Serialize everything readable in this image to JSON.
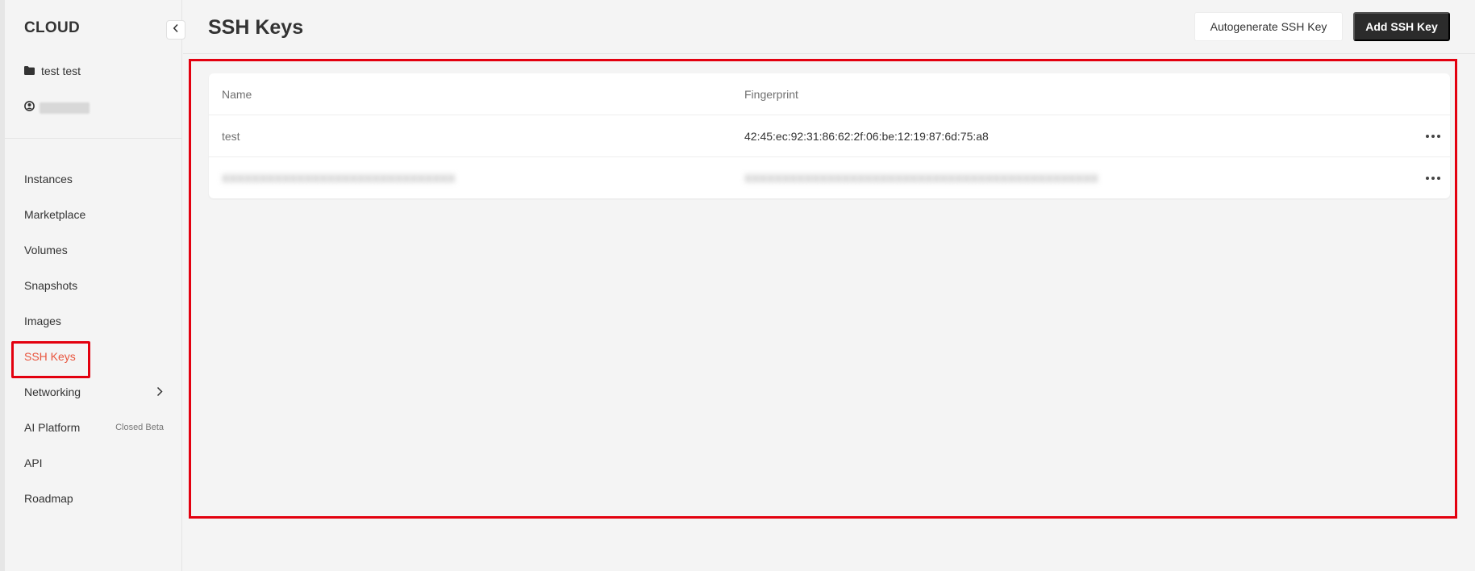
{
  "app": {
    "brand": "CLOUD"
  },
  "sidebar": {
    "project_name": "test test",
    "items": [
      {
        "label": "Instances"
      },
      {
        "label": "Marketplace"
      },
      {
        "label": "Volumes"
      },
      {
        "label": "Snapshots"
      },
      {
        "label": "Images"
      },
      {
        "label": "SSH Keys",
        "active": true
      },
      {
        "label": "Networking"
      },
      {
        "label": "AI Platform",
        "tag": "Closed Beta"
      },
      {
        "label": "API"
      },
      {
        "label": "Roadmap"
      }
    ]
  },
  "header": {
    "title": "SSH Keys",
    "autogenerate_label": "Autogenerate SSH Key",
    "add_label": "Add SSH Key"
  },
  "table": {
    "columns": {
      "name": "Name",
      "fingerprint": "Fingerprint"
    },
    "rows": [
      {
        "name": "test",
        "fingerprint": "42:45:ec:92:31:86:62:2f:06:be:12:19:87:6d:75:a8"
      },
      {
        "name": "XXXXXXXXXXXXXXXXXXXXXXXXXXXXXXX",
        "fingerprint": "XXXXXXXXXXXXXXXXXXXXXXXXXXXXXXXXXXXXXXXXXXXXXXX",
        "redacted": true
      }
    ]
  },
  "colors": {
    "accent": "#e8553e",
    "highlight_outline": "#e3000f",
    "primary_button": "#2b2b2b"
  }
}
